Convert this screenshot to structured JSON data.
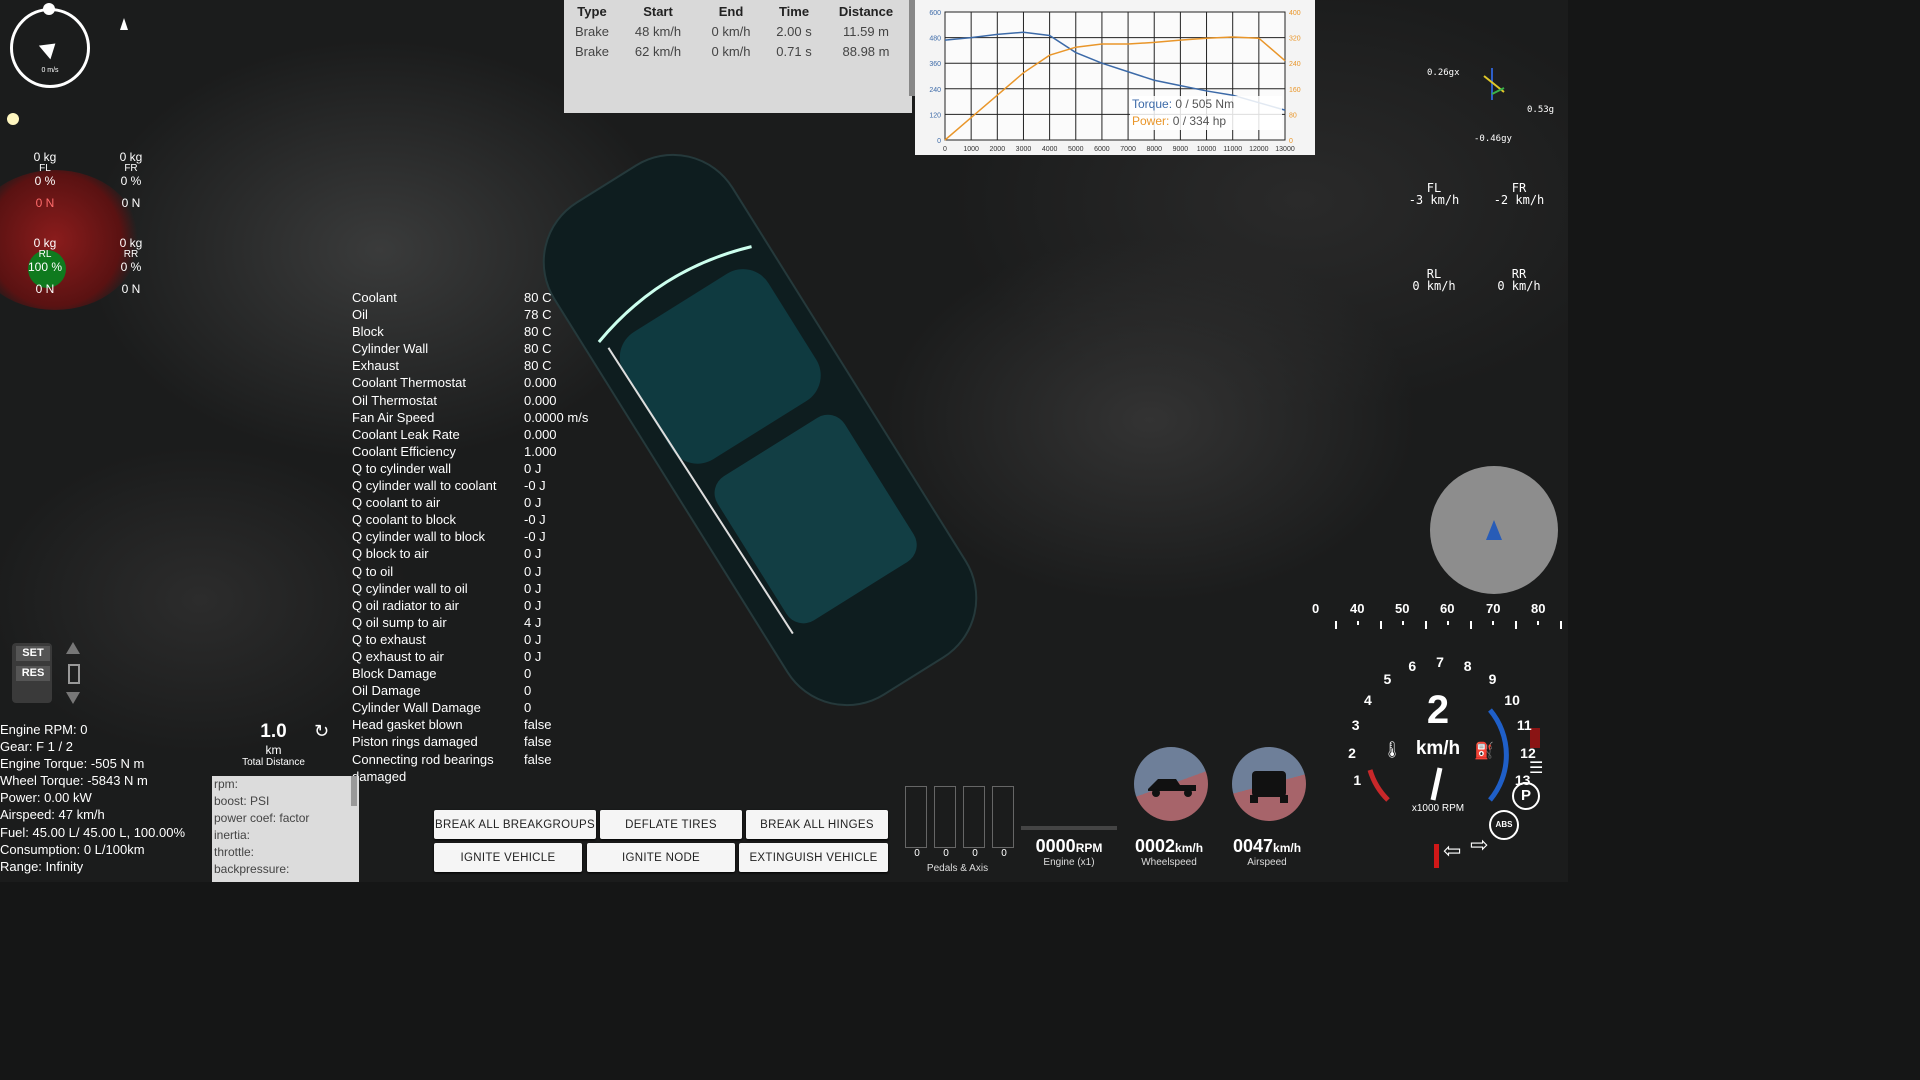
{
  "compass": {
    "speed": "0 m/s"
  },
  "wheels": [
    {
      "id": "FL",
      "mass": "0 kg",
      "pct": "0 %",
      "force": "0 N",
      "force_color": "#ff5a5a"
    },
    {
      "id": "FR",
      "mass": "0 kg",
      "pct": "0 %",
      "force": "0 N",
      "force_color": "#ffffff"
    },
    {
      "id": "RL",
      "mass": "0 kg",
      "pct": "100 %",
      "force": "0 N",
      "force_color": "#ffffff"
    },
    {
      "id": "RR",
      "mass": "0 kg",
      "pct": "0 %",
      "force": "0 N",
      "force_color": "#ffffff"
    }
  ],
  "brake_table": {
    "headers": [
      "Type",
      "Start",
      "End",
      "Time",
      "Distance"
    ],
    "rows": [
      [
        "Brake",
        "48 km/h",
        "0 km/h",
        "2.00 s",
        "11.59 m"
      ],
      [
        "Brake",
        "62 km/h",
        "0 km/h",
        "0.71 s",
        "88.98 m"
      ]
    ]
  },
  "torque_chart": {
    "torque_label": "Torque:",
    "torque_value": "0 / 505 Nm",
    "power_label": "Power:",
    "power_value": "0 / 334 hp",
    "torque_color": "#3c6aa8",
    "power_color": "#e9962a",
    "left_ticks": [
      "600",
      "480",
      "360",
      "240",
      "120",
      "0"
    ],
    "right_ticks": [
      "400",
      "320",
      "240",
      "160",
      "80",
      "0"
    ],
    "x_ticks": [
      "0",
      "1000",
      "2000",
      "3000",
      "4000",
      "5000",
      "6000",
      "7000",
      "8000",
      "9000",
      "10000",
      "11000",
      "12000",
      "13000"
    ]
  },
  "chart_data": {
    "type": "line",
    "x": [
      0,
      1000,
      2000,
      3000,
      4000,
      5000,
      6000,
      7000,
      8000,
      9000,
      10000,
      11000,
      12000,
      13000
    ],
    "series": [
      {
        "name": "Torque",
        "values": [
          468,
          480,
          495,
          505,
          490,
          410,
          360,
          320,
          280,
          255,
          230,
          210,
          175,
          140
        ]
      },
      {
        "name": "Power",
        "values": [
          0,
          70,
          140,
          210,
          265,
          290,
          300,
          300,
          305,
          312,
          318,
          322,
          318,
          248
        ]
      }
    ],
    "ylim_left": [
      0,
      600
    ],
    "ylim_right": [
      0,
      400
    ],
    "xlim": [
      0,
      13000
    ]
  },
  "engine_stats": [
    [
      "Coolant",
      "80 C"
    ],
    [
      "Oil",
      "78 C"
    ],
    [
      "Block",
      "80 C"
    ],
    [
      "Cylinder Wall",
      "80 C"
    ],
    [
      "Exhaust",
      "80 C"
    ],
    [
      "Coolant Thermostat",
      "0.000"
    ],
    [
      "Oil Thermostat",
      "0.000"
    ],
    [
      "Fan Air Speed",
      "0.0000 m/s"
    ],
    [
      "Coolant Leak Rate",
      "0.000"
    ],
    [
      "Coolant Efficiency",
      "1.000"
    ],
    [
      "Q to cylinder wall",
      "0 J"
    ],
    [
      "Q cylinder wall to coolant",
      "-0 J"
    ],
    [
      "Q coolant to air",
      "0 J"
    ],
    [
      "Q coolant to block",
      "-0 J"
    ],
    [
      "Q cylinder wall to block",
      "-0 J"
    ],
    [
      "Q block to air",
      "0 J"
    ],
    [
      "Q to oil",
      "0 J"
    ],
    [
      "Q cylinder wall to oil",
      "0 J"
    ],
    [
      "Q oil radiator to air",
      "0 J"
    ],
    [
      "Q oil sump to air",
      "4 J"
    ],
    [
      "Q to exhaust",
      "0 J"
    ],
    [
      "Q exhaust to air",
      "0 J"
    ],
    [
      "Block Damage",
      "0"
    ],
    [
      "Oil Damage",
      "0"
    ],
    [
      "Cylinder Wall Damage",
      "0"
    ],
    [
      "Head gasket blown",
      "false"
    ],
    [
      "Piston rings damaged",
      "false"
    ],
    [
      "Connecting rod bearings damaged",
      "false"
    ]
  ],
  "cruise": {
    "set": "SET",
    "res": "RES"
  },
  "info": [
    "Engine RPM: 0",
    "Gear: F 1 / 2",
    "Engine Torque: -505 N m",
    "Wheel Torque: -5843 N m",
    "Power: 0.00 kW",
    "Airspeed: 47 km/h",
    "Fuel: 45.00 L/ 45.00 L, 100.00%",
    "Consumption: 0 L/100km",
    "Range: Infinity"
  ],
  "distance": {
    "value": "1.0",
    "unit": "km",
    "label": "Total Distance"
  },
  "boost_panel": [
    "rpm:",
    "boost: PSI",
    "power coef: factor",
    "inertia:",
    "throttle:",
    "backpressure:"
  ],
  "buttons": {
    "break_breakgroups": "BREAK ALL BREAKGROUPS",
    "deflate": "DEFLATE TIRES",
    "break_hinges": "BREAK ALL HINGES",
    "ignite_vehicle": "IGNITE VEHICLE",
    "ignite_node": "IGNITE NODE",
    "extinguish": "EXTINGUISH VEHICLE"
  },
  "pedals": {
    "values": [
      "0",
      "0",
      "0",
      "0"
    ],
    "label": "Pedals & Axis"
  },
  "gauges": {
    "engine": {
      "value": "0000",
      "unit": "RPM",
      "label": "Engine (x1)"
    },
    "wheel": {
      "value": "0002",
      "unit": "km/h",
      "label": "Wheelspeed"
    },
    "air": {
      "value": "0047",
      "unit": "km/h",
      "label": "Airspeed"
    }
  },
  "gforce": {
    "x": "0.26gx",
    "z": "0.53g",
    "y": "-0.46gy"
  },
  "wheel_speeds": [
    {
      "id": "FL",
      "v": "-3 km/h"
    },
    {
      "id": "FR",
      "v": "-2 km/h"
    },
    {
      "id": "RL",
      "v": "0 km/h"
    },
    {
      "id": "RR",
      "v": "0 km/h"
    }
  ],
  "speed_strip": [
    "0",
    "40",
    "50",
    "60",
    "70",
    "80"
  ],
  "dash": {
    "gear": "2",
    "unit": "km/h",
    "rpm_label": "x1000 RPM",
    "rpm_ticks": [
      "1",
      "2",
      "3",
      "4",
      "5",
      "6",
      "7",
      "8",
      "9",
      "10",
      "11",
      "12",
      "13"
    ],
    "abs": "ABS",
    "p": "P"
  }
}
